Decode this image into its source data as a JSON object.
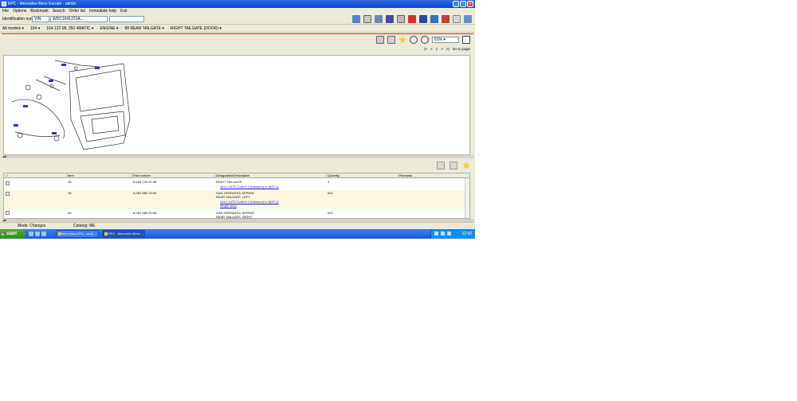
{
  "window": {
    "title": "EPC - Mercedes-Benz Europe - admin",
    "controls": [
      "_",
      "□",
      "×"
    ]
  },
  "menu": [
    "File",
    "Options",
    "Bookmark",
    "Search",
    "Order list",
    "Immediate help",
    "Exit"
  ],
  "identification": {
    "label": "Identification number",
    "type_value": "VIN",
    "number_value": "WDC1641221A..."
  },
  "breadcrumb": [
    "All models",
    "164",
    "164.122 ML 350 4MATIC",
    "ENGINE",
    "88 REAR TAILGATE",
    "RIGHT TAILGATE (DOOR)"
  ],
  "diagram_tools": {
    "zoom_value": "51%"
  },
  "pager": {
    "first": "|<",
    "prev": "<",
    "page": "1",
    "next": ">",
    "last": ">|",
    "goto": "Go to page"
  },
  "grid": {
    "columns": [
      "Item",
      "Part number",
      "Designation/Description",
      "Quantity",
      "Remarks"
    ],
    "rows": [
      {
        "item": "10",
        "part_number": "A 164 740 00 45",
        "designation": "RIGHT TAILGATE",
        "note": "164.1 DCS Control 4 (hamann) to 8(ST.1)",
        "quantity": "1"
      },
      {
        "item": "15",
        "part_number": "A 251 980 19 64",
        "designation": "GAS-OPERATED SPRING",
        "note2": "REAR TAILGATE, LEFT",
        "note": "164.1 DCS Control 4 (hamann) to 8(ST.1)",
        "extra": "Single label",
        "quantity": "001"
      },
      {
        "item": "20",
        "part_number": "A 251 980 20 64",
        "designation": "GAS-OPERATED SPRING",
        "note2": "REAR TAILGATE, RIGHT",
        "quantity": "001"
      }
    ]
  },
  "status": {
    "left": "Mode: Changes",
    "mid": "Catalog: ME"
  },
  "taskbar": {
    "start": "start",
    "tasks": [
      "Mercedes EPC - work...",
      "EPC - Mercedes-Benz ..."
    ],
    "clock": "12:42"
  },
  "colors": {
    "titlebar": "#0a46c8",
    "link": "#1a1ad8",
    "highlight_row": "#fbf7e2"
  }
}
